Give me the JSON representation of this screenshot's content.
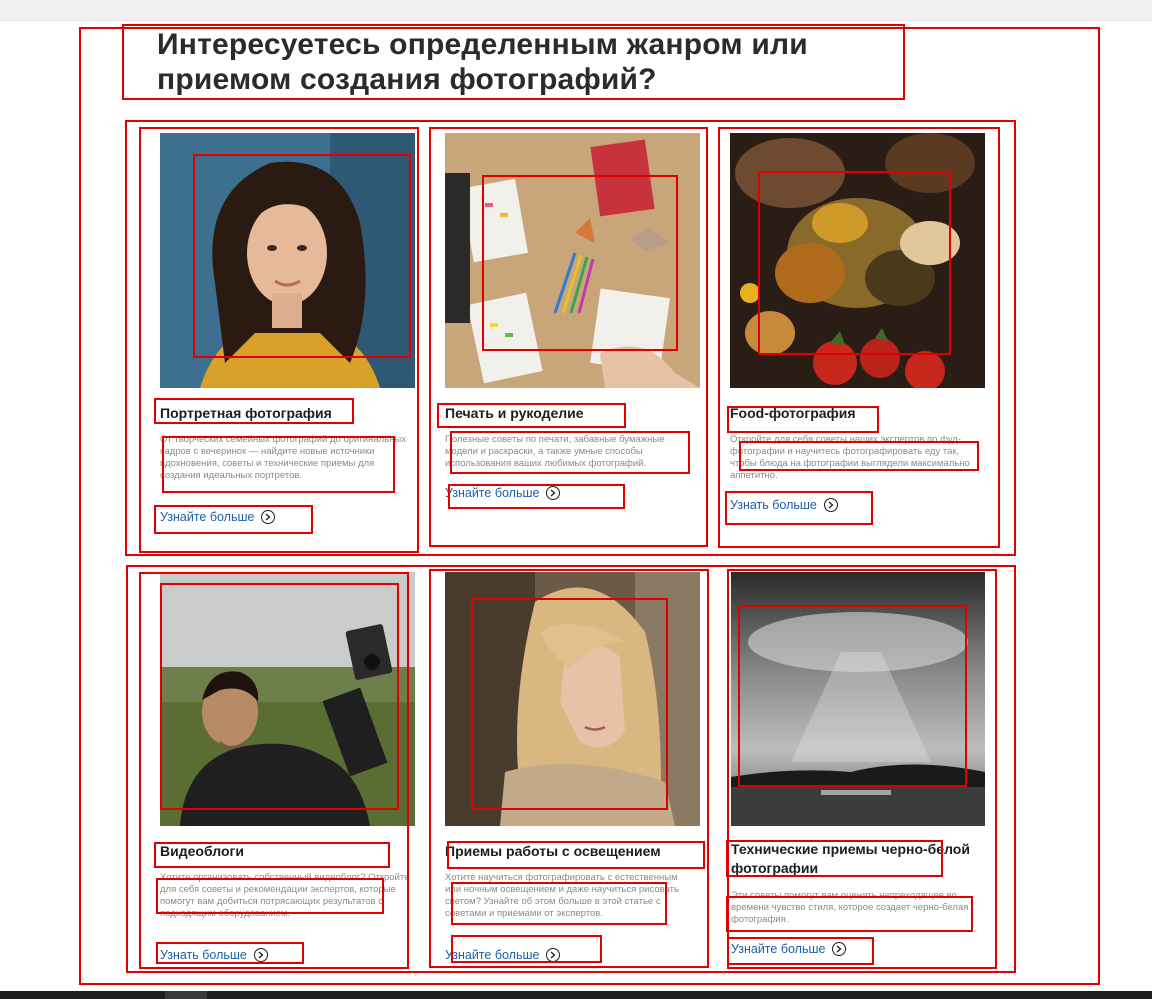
{
  "page": {
    "title_line1": "Интересуетесь определенным жанром или",
    "title_line2": "приемом создания фотографий?"
  },
  "cards": [
    {
      "title": "Портретная фотография",
      "text": "От творческих семейных фотографий до оригинальных кадров с вечеринок — найдите новые источники вдохновения, советы и технические приемы для создания идеальных портретов.",
      "link": "Узнайте больше",
      "image": "portrait-woman-curly-hair"
    },
    {
      "title": "Печать и рукоделие",
      "text": "Полезные советы по печати, забавные бумажные модели и раскраски, а также умные способы использования ваших любимых фотографий.",
      "link": "Узнайте больше",
      "image": "crafts-desk-top-view"
    },
    {
      "title": "Food-фотография",
      "text": "Откройте для себя советы наших экспертов по фуд-фотографии и научитесь фотографировать еду так, чтобы блюда на фотографии выглядели максимально аппетитно.",
      "link": "Узнать больше",
      "image": "spices-and-tomatoes"
    },
    {
      "title": "Видеоблоги",
      "text": "Хотите организовать собственный видеоблог? Откройте для себя советы и рекомендации экспертов, которые помогут вам добиться потрясающих результатов с подходящим оборудованием.",
      "link": "Узнать больше",
      "image": "man-filming-selfie"
    },
    {
      "title": "Приемы работы с освещением",
      "text": "Хотите научиться фотографировать с естественным или ночным освещением и даже научиться рисовать светом? Узнайте об этом больше в этой статье с советами и приемами от экспертов.",
      "link": "Узнайте больше",
      "image": "blonde-woman-window-light"
    },
    {
      "title": "Технические приемы черно-белой фотографии",
      "text": "Эти советы помогут вам оценить непреходящее во времени чувство стиля, которое создает черно-белая фотография.",
      "link": "Узнайте больше",
      "image": "black-white-sea-clouds"
    }
  ],
  "colors": {
    "title": "#2b2b2b",
    "link": "#1b5fa8",
    "body": "#8a8a8a",
    "annotation": "#e00000"
  }
}
